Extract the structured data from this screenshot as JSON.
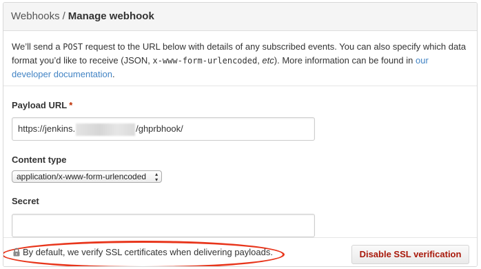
{
  "header": {
    "crumb": "Webhooks",
    "separator": "/",
    "title": "Manage webhook"
  },
  "intro": {
    "t1": "We’ll send a ",
    "code1": "POST",
    "t2": " request to the URL below with details of any subscribed events. You can also specify which data format you’d like to receive (JSON, ",
    "code2": "x-www-form-urlencoded",
    "t3": ", ",
    "etc": "etc",
    "t4": "). More information can be found in ",
    "link": "our developer documentation",
    "t5": "."
  },
  "payload": {
    "label": "Payload URL",
    "required_mark": "*",
    "value_prefix": "https://jenkins.",
    "value_suffix": "/ghprbhook/"
  },
  "content_type": {
    "label": "Content type",
    "selected": "application/x-www-form-urlencoded"
  },
  "secret": {
    "label": "Secret",
    "value": ""
  },
  "ssl": {
    "message": "By default, we verify SSL certificates when delivering payloads.",
    "disable_button": "Disable SSL verification",
    "lock_icon": "lock-icon"
  },
  "colors": {
    "link": "#4183c4",
    "danger_text": "#a8180a",
    "annotation": "#e8361c"
  }
}
